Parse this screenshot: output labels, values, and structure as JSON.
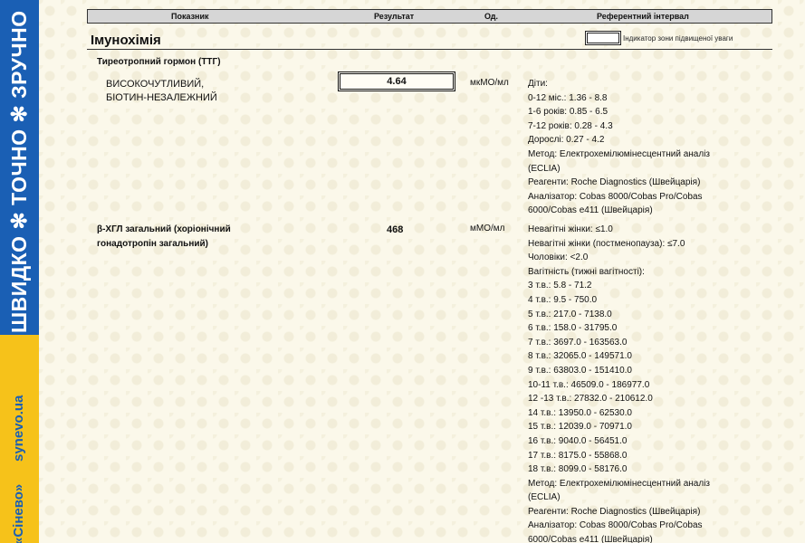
{
  "brand_strip": {
    "slogan": "ШВИДКО ✻ ТОЧНО ✻ ЗРУЧНО",
    "website": "synevo.ua",
    "brand": "«Сінево»"
  },
  "colors": {
    "blue": "#1a5fb4",
    "yellow": "#f6c21a",
    "background": "#fbf8ea"
  },
  "table_header": {
    "indicator": "Показник",
    "result": "Результат",
    "unit": "Од.",
    "reference": "Референтний інтервал"
  },
  "section": {
    "title": "Імунохімія",
    "legend_text": "Індикатор зони підвищеної уваги"
  },
  "tests": [
    {
      "group_name": "Тиреотропний гормон (ТТГ)",
      "name_line1": "ВИСОКОЧУТЛИВИЙ,",
      "name_line2": "БІОТИН-НЕЗАЛЕЖНИЙ",
      "result": "4.64",
      "unit": "мкМО/мл",
      "reference": [
        "Діти:",
        "0-12 міс.: 1.36 - 8.8",
        "1-6 років: 0.85 - 6.5",
        "7-12 років: 0.28 - 4.3",
        "Дорослі: 0.27 - 4.2",
        "Метод: Електрохемілюмінесцентний аналіз",
        "(ECLIA)",
        "Реагенти: Roche Diagnostics (Швейцарія)",
        "Аналізатор: Cobas 8000/Cobas Pro/Cobas",
        "6000/Cobas e411 (Швейцарія)"
      ]
    },
    {
      "name_line1": "β-ХГЛ загальний (хоріонічний",
      "name_line2": "гонадотропін загальний)",
      "result": "468",
      "unit": "мМО/мл",
      "reference": [
        "Невагітні жінки: ≤1.0",
        "Невагітні жінки (постменопауза): ≤7.0",
        "Чоловіки: <2.0",
        "Вагітність (тижні вагітності):",
        "3 т.в.: 5.8 - 71.2",
        "4 т.в.: 9.5 - 750.0",
        "5 т.в.: 217.0 - 7138.0",
        "6 т.в.: 158.0 - 31795.0",
        "7 т.в.: 3697.0 - 163563.0",
        "8 т.в.: 32065.0 - 149571.0",
        "9 т.в.: 63803.0 - 151410.0",
        "10-11 т.в.: 46509.0 - 186977.0",
        "12 -13 т.в.: 27832.0 - 210612.0",
        "14 т.в.: 13950.0 - 62530.0",
        "15 т.в.: 12039.0 - 70971.0",
        "16 т.в.: 9040.0 - 56451.0",
        "17 т.в.: 8175.0 - 55868.0",
        "18 т.в.: 8099.0 - 58176.0",
        "Метод: Електрохемілюмінесцентний аналіз",
        "(ECLIA)",
        "Реагенти: Roche Diagnostics (Швейцарія)",
        "Аналізатор: Cobas 8000/Cobas Pro/Cobas",
        "6000/Cobas e411 (Швейцарія)"
      ]
    }
  ]
}
